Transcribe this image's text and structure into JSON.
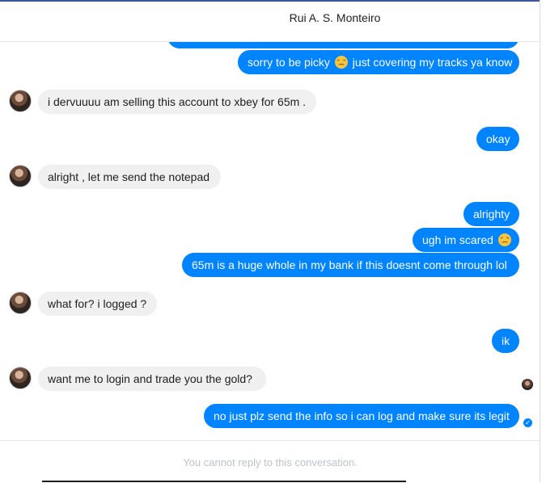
{
  "header": {
    "contact_name": "Rui A. S. Monteiro"
  },
  "messages": [
    {
      "dir": "out",
      "text": ""
    },
    {
      "dir": "out",
      "text_before": "sorry to be picky ",
      "emoji": "disappointed-face",
      "text_after": " just covering my tracks ya know"
    },
    {
      "dir": "in",
      "text": "i dervuuuu am selling this account to xbey for 65m ."
    },
    {
      "dir": "out",
      "text": "okay"
    },
    {
      "dir": "in",
      "text": "alright , let me send the notepad"
    },
    {
      "dir": "out",
      "text": "alrighty"
    },
    {
      "dir": "out",
      "text_before": "ugh im scared ",
      "emoji": "disappointed-face"
    },
    {
      "dir": "out",
      "text": "65m is a huge whole in my bank if this doesnt come through lol"
    },
    {
      "dir": "in",
      "text": "what for? i logged ?"
    },
    {
      "dir": "out",
      "text": "ik"
    },
    {
      "dir": "in",
      "text": "want me to login and trade you the gold?"
    },
    {
      "dir": "out",
      "text": "no just plz send the info so i can log and make sure its legit"
    }
  ],
  "footer": {
    "notice": "You cannot reply to this conversation."
  },
  "colors": {
    "outgoing": "#0084ff",
    "incoming": "#f1f0f0",
    "accent_line": "#3b5998"
  }
}
